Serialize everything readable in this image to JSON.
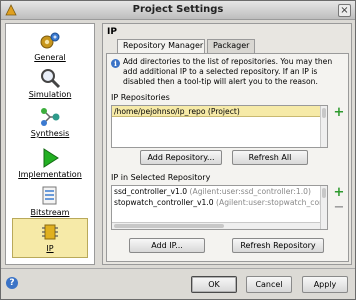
{
  "window": {
    "title": "Project Settings"
  },
  "nav": {
    "items": [
      {
        "label": "General",
        "icon": "general-icon"
      },
      {
        "label": "Simulation",
        "icon": "simulation-icon"
      },
      {
        "label": "Synthesis",
        "icon": "synthesis-icon"
      },
      {
        "label": "Implementation",
        "icon": "implementation-icon"
      },
      {
        "label": "Bitstream",
        "icon": "bitstream-icon"
      },
      {
        "label": "IP",
        "icon": "ip-icon",
        "selected": true
      }
    ]
  },
  "panel": {
    "title": "IP",
    "tabs": [
      {
        "label": "Repository Manager",
        "active": true
      },
      {
        "label": "Packager",
        "active": false
      }
    ],
    "info_text": "Add directories to the list of repositories. You may then add additional IP to a selected repository. If an IP is disabled then a tool-tip will alert you to the reason.",
    "repositories": {
      "label": "IP Repositories",
      "items": [
        "/home/pejohnso/ip_repo (Project)"
      ],
      "add_button": "Add Repository...",
      "refresh_button": "Refresh All"
    },
    "ip_list": {
      "label": "IP in Selected Repository",
      "items": [
        {
          "name": "ssd_controller_v1.0",
          "vlnv": "(Agilent:user:ssd_controller:1.0)"
        },
        {
          "name": "stopwatch_controller_v1.0",
          "vlnv": "(Agilent:user:stopwatch_cont"
        }
      ],
      "add_button": "Add IP...",
      "refresh_button": "Refresh Repository"
    }
  },
  "footer": {
    "ok": "OK",
    "cancel": "Cancel",
    "apply": "Apply"
  },
  "colors": {
    "selection": "#f6eaa8",
    "add_green": "#2e9a2e",
    "info_blue": "#3b73c6"
  }
}
